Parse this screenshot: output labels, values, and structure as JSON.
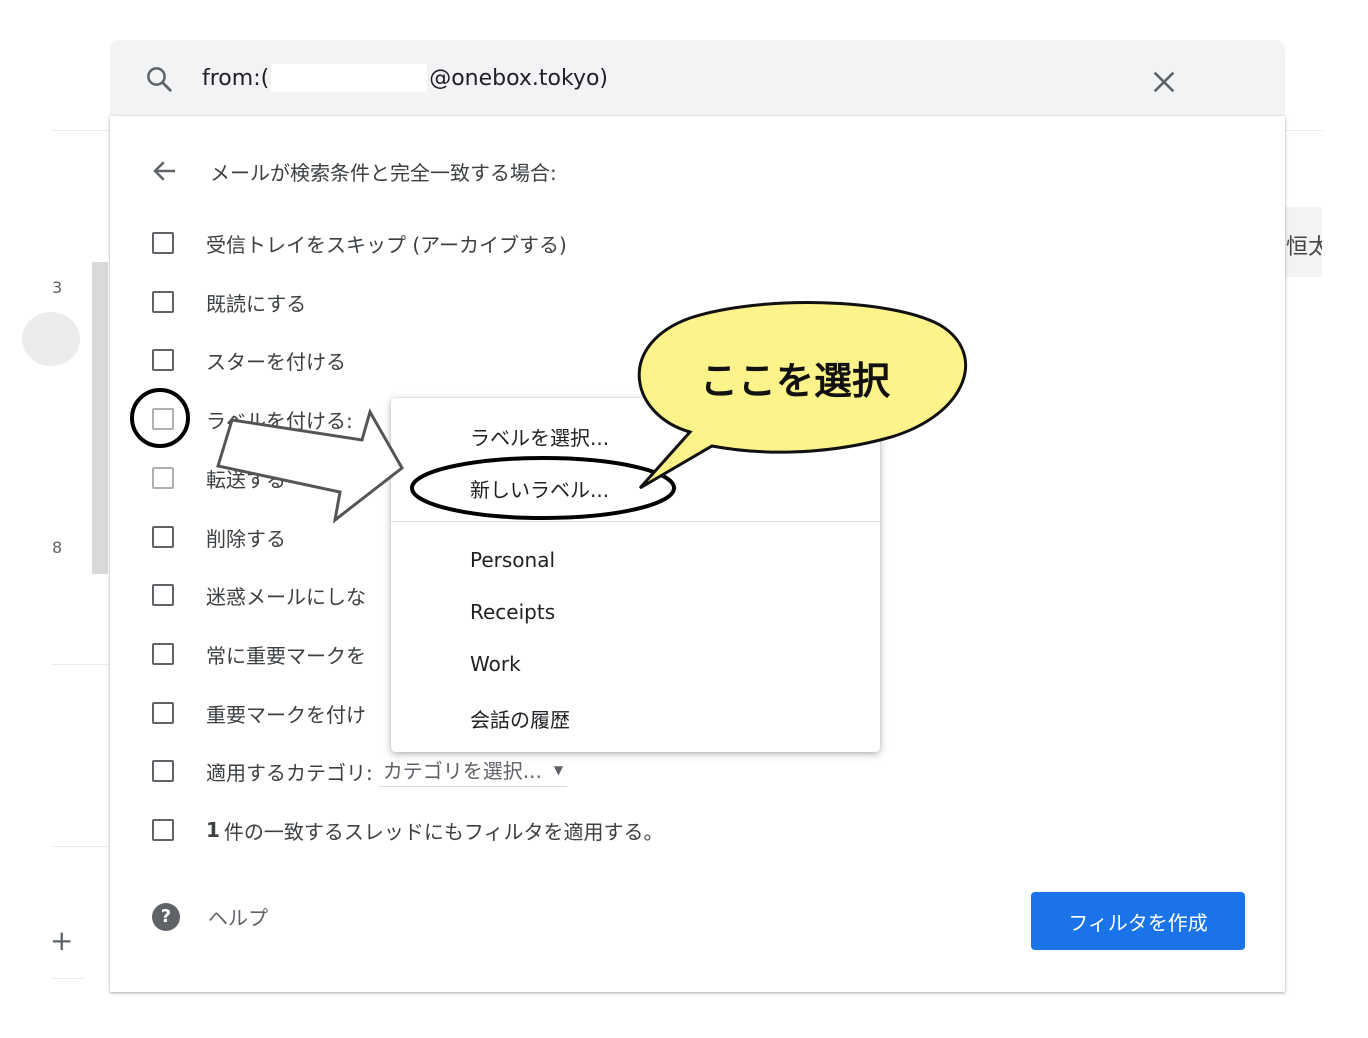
{
  "search": {
    "query_prefix": "from:(",
    "query_suffix": "@onebox.tokyo)"
  },
  "background": {
    "nums": [
      "3",
      "8"
    ],
    "right_text": "恒太",
    "plus": "+"
  },
  "panel": {
    "back_text": "メールが検索条件と完全一致する場合:",
    "options": {
      "skip_inbox": "受信トレイをスキップ (アーカイブする)",
      "mark_read": "既読にする",
      "star": "スターを付ける",
      "apply_label": "ラベルを付ける:",
      "forward": "転送する",
      "forward_link": "転送",
      "delete": "削除する",
      "never_spam": "迷惑メールにしな",
      "always_important": "常に重要マークを",
      "mark_important": "重要マークを付け",
      "category_label": "適用するカテゴリ:",
      "category_select": "カテゴリを選択...",
      "apply_count": "1",
      "apply_existing": "件の一致するスレッドにもフィルタを適用する。"
    },
    "help": "ヘルプ",
    "help_icon_glyph": "?",
    "create_button": "フィルタを作成"
  },
  "menu": {
    "choose_label": "ラベルを選択...",
    "new_label": "新しいラベル...",
    "labels": [
      "Personal",
      "Receipts",
      "Work",
      "会話の履歴"
    ]
  },
  "annotation": {
    "callout": "ここを選択",
    "callout_color": "#fdf38b"
  },
  "colors": {
    "accent": "#1a73e8",
    "searchbar_bg": "#f1f3f4"
  }
}
